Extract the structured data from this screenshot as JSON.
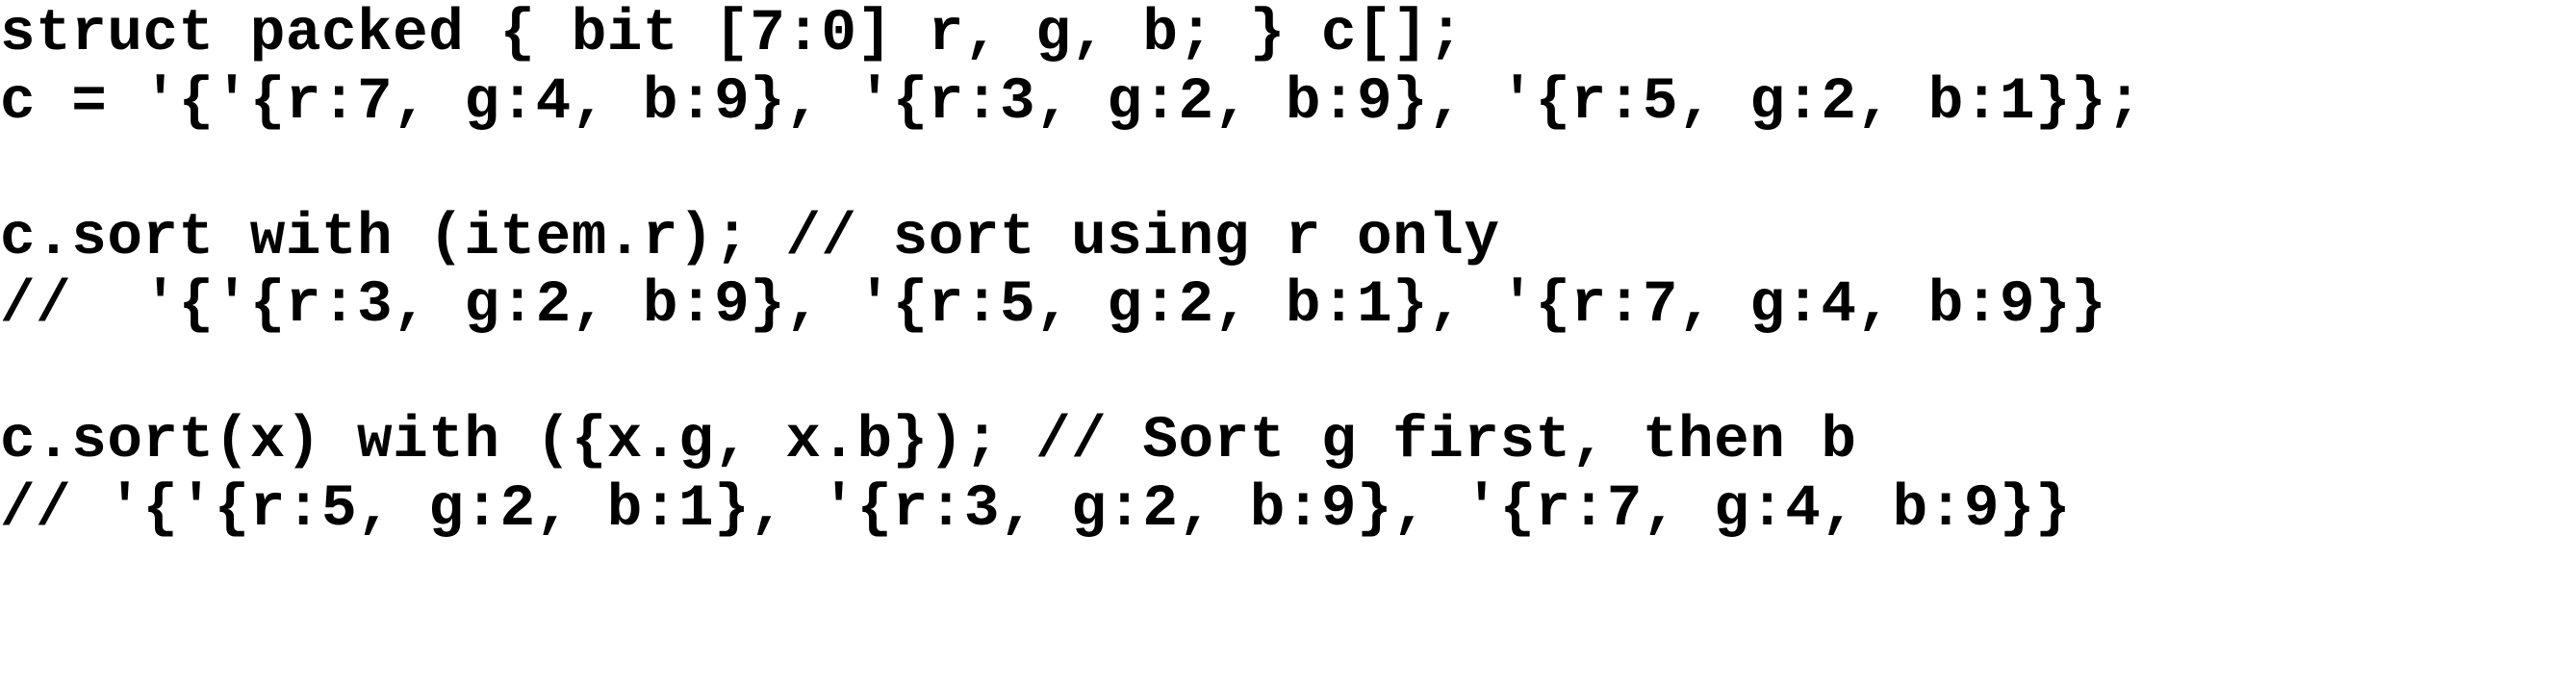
{
  "code": {
    "lines": [
      "struct packed { bit [7:0] r, g, b; } c[];",
      "c = '{'{r:7, g:4, b:9}, '{r:3, g:2, b:9}, '{r:5, g:2, b:1}};",
      "",
      "c.sort with (item.r); // sort using r only",
      "//  '{'{r:3, g:2, b:9}, '{r:5, g:2, b:1}, '{r:7, g:4, b:9}}",
      "",
      "c.sort(x) with ({x.g, x.b}); // Sort g first, then b",
      "// '{'{r:5, g:2, b:1}, '{r:3, g:2, b:9}, '{r:7, g:4, b:9}}"
    ]
  }
}
